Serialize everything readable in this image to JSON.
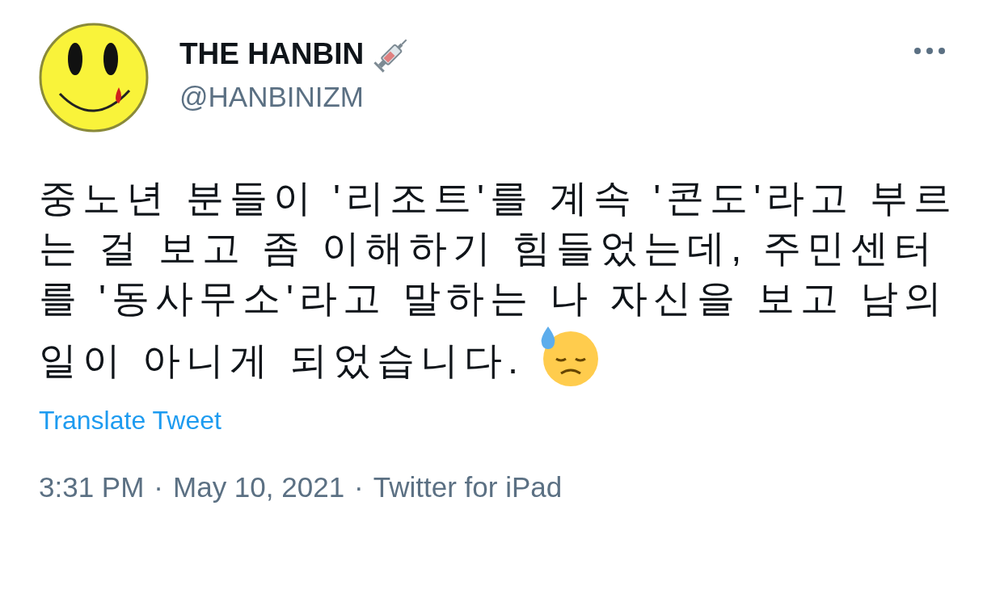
{
  "author": {
    "name": "THE HANBIN",
    "handle": "@HANBINIZM"
  },
  "tweet": {
    "text": "중노년 분들이 '리조트'를 계속 '콘도'라고 부르는 걸 보고 좀 이해하기 힘들었는데, 주민센터를 '동사무소'라고 말하는 나 자신을 보고 남의 일이 아니게 되었습니다."
  },
  "translate_link": "Translate Tweet",
  "meta": {
    "time": "3:31 PM",
    "separator": "·",
    "date": "May 10, 2021",
    "source": "Twitter for iPad"
  }
}
